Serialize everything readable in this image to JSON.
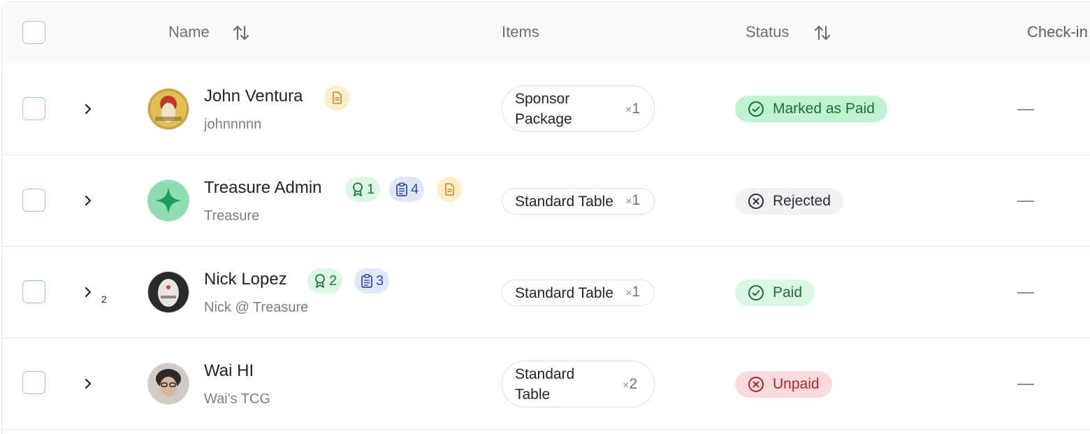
{
  "header": {
    "name": "Name",
    "items": "Items",
    "status": "Status",
    "checkin": "Check-in"
  },
  "rows": [
    {
      "name": "John Ventura",
      "subtitle": "johnnnnn",
      "item": {
        "line1": "Sponsor",
        "line2": "Package",
        "qty": "1"
      },
      "status": "Marked as Paid",
      "checkin": "—"
    },
    {
      "name": "Treasure Admin",
      "subtitle": "Treasure",
      "award_count": "1",
      "clip_count": "4",
      "item": {
        "line1": "Standard Table",
        "qty": "1"
      },
      "status": "Rejected",
      "checkin": "—"
    },
    {
      "name": "Nick Lopez",
      "subtitle": "Nick @ Treasure",
      "award_count": "2",
      "clip_count": "3",
      "sub_count": "2",
      "item": {
        "line1": "Standard Table",
        "qty": "1"
      },
      "status": "Paid",
      "checkin": "—"
    },
    {
      "name": "Wai HI",
      "subtitle": "Wai's TCG",
      "item": {
        "line1": "Standard",
        "line2": "Table",
        "qty": "2"
      },
      "status": "Unpaid",
      "checkin": "—"
    }
  ],
  "icons": {
    "sort": "sort-arrows-icon",
    "chevron": "chevron-right-icon",
    "doc": "document-icon",
    "award": "award-icon",
    "clipboard": "clipboard-list-icon",
    "check_circle": "check-circle-icon",
    "x_circle": "x-circle-icon"
  },
  "colors": {
    "paid_bg": "#d9f7e2",
    "paid_fg": "#1c6d38",
    "unpaid_bg": "#fbdadb",
    "unpaid_fg": "#a3272e",
    "rejected_bg": "#f0f1f3",
    "doc_badge_bg": "#fcefc8",
    "award_badge_bg": "#dcf7e5",
    "clip_badge_bg": "#dfe7fb"
  }
}
